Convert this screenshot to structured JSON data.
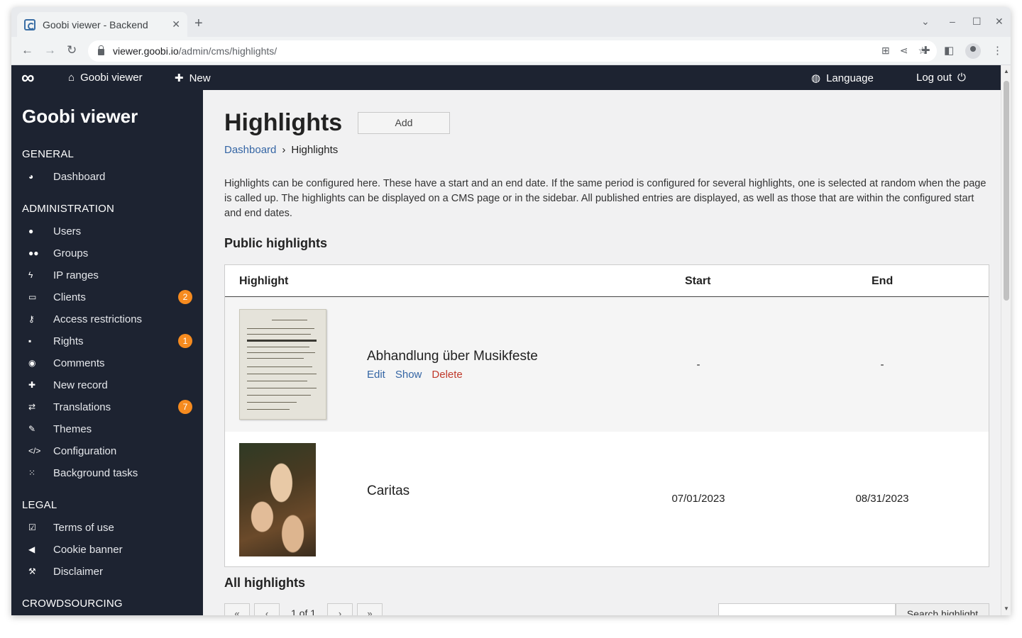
{
  "browser": {
    "tab_title": "Goobi viewer - Backend",
    "new_tab": "+",
    "tab_close": "✕",
    "url_host": "viewer.goobi.io",
    "url_path": "/admin/cms/highlights/"
  },
  "topbar": {
    "home_label": "Goobi viewer",
    "new_label": "New",
    "language_label": "Language",
    "logout_label": "Log out"
  },
  "sidebar": {
    "title": "Goobi viewer",
    "sections": {
      "general": "GENERAL",
      "administration": "ADMINISTRATION",
      "legal": "LEGAL",
      "crowdsourcing": "CROWDSOURCING"
    },
    "items": [
      {
        "label": "Dashboard",
        "icon": "dashboard-icon"
      },
      {
        "label": "Users",
        "icon": "user-icon"
      },
      {
        "label": "Groups",
        "icon": "users-icon"
      },
      {
        "label": "IP ranges",
        "icon": "bolt-icon"
      },
      {
        "label": "Clients",
        "icon": "desktop-icon",
        "badge": "2"
      },
      {
        "label": "Access restrictions",
        "icon": "key-icon"
      },
      {
        "label": "Rights",
        "icon": "lock-icon",
        "badge": "1"
      },
      {
        "label": "Comments",
        "icon": "comments-icon"
      },
      {
        "label": "New record",
        "icon": "plus-icon"
      },
      {
        "label": "Translations",
        "icon": "exchange-icon",
        "badge": "7"
      },
      {
        "label": "Themes",
        "icon": "brush-icon"
      },
      {
        "label": "Configuration",
        "icon": "code-icon"
      },
      {
        "label": "Background tasks",
        "icon": "spinner-icon"
      },
      {
        "label": "Terms of use",
        "icon": "checkbox-icon"
      },
      {
        "label": "Cookie banner",
        "icon": "bullhorn-icon"
      },
      {
        "label": "Disclaimer",
        "icon": "gavel-icon"
      }
    ]
  },
  "main": {
    "title": "Highlights",
    "add_label": "Add",
    "breadcrumb": {
      "root": "Dashboard",
      "sep": "›",
      "current": "Highlights"
    },
    "intro": "Highlights can be configured here. These have a start and an end date. If the same period is configured for several highlights, one is selected at random when the page is called up. The highlights can be displayed on a CMS page or in the sidebar. All published entries are displayed, as well as those that are within the configured start and end dates.",
    "public_heading": "Public highlights",
    "all_heading": "All highlights",
    "columns": [
      "Highlight",
      "Start",
      "End"
    ],
    "rows": [
      {
        "title": "Abhandlung über Musikfeste",
        "start": "-",
        "end": "-",
        "actions": [
          "Edit",
          "Show",
          "Delete"
        ]
      },
      {
        "title": "Caritas",
        "start": "07/01/2023",
        "end": "08/31/2023"
      }
    ],
    "pager": {
      "first": "«",
      "prev": "‹",
      "label": "1 of 1",
      "next": "›",
      "last": "»"
    },
    "search_button": "Search highlight"
  }
}
